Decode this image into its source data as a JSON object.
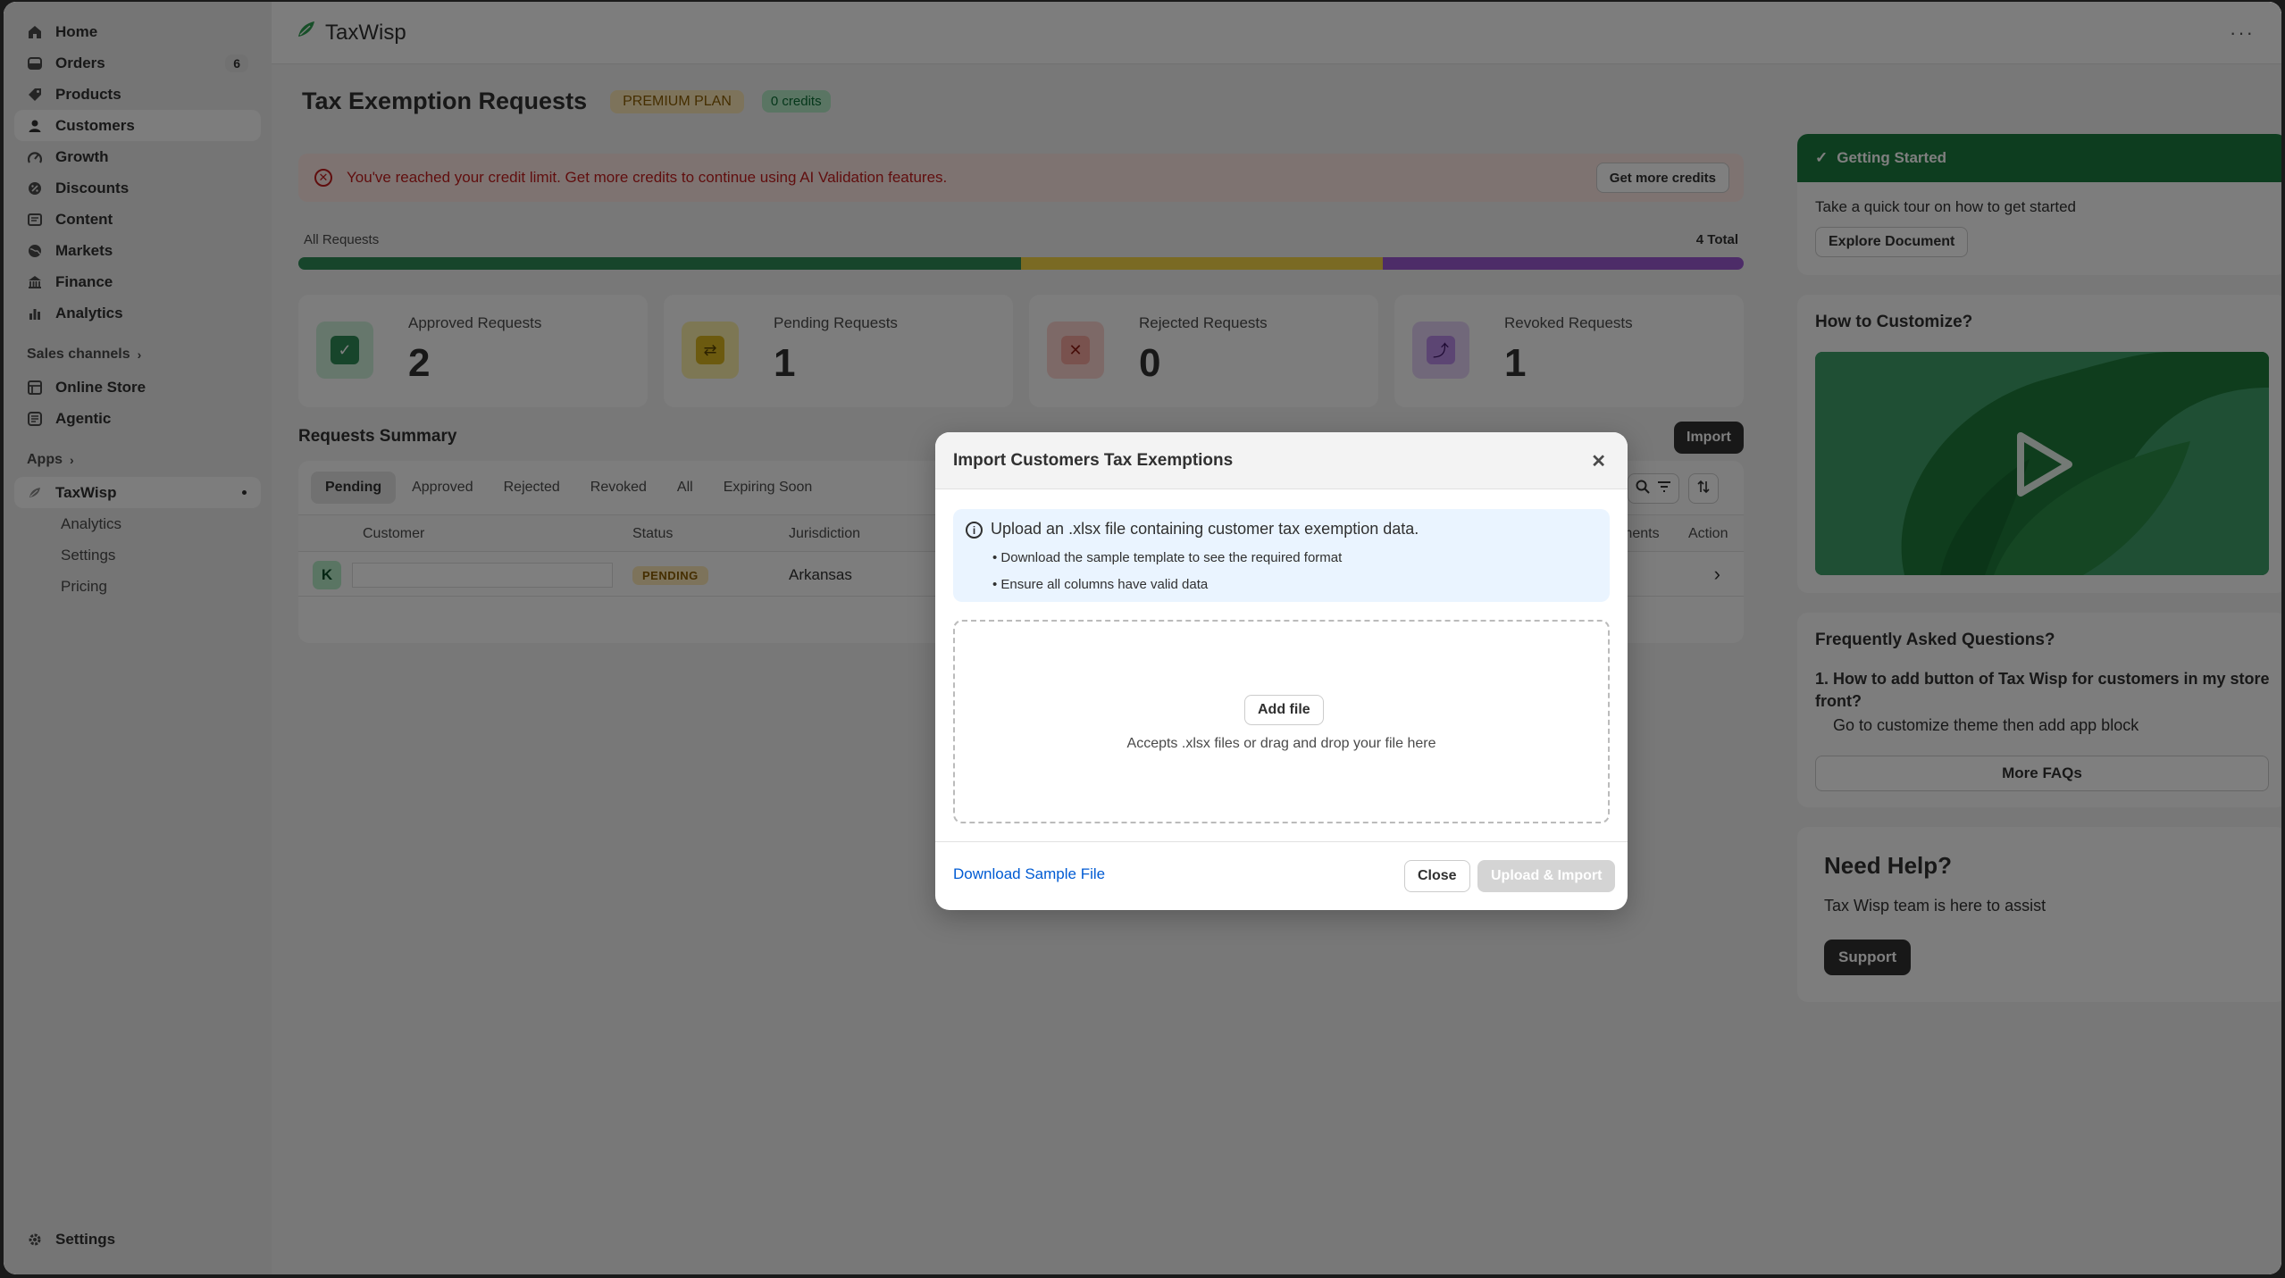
{
  "colors": {
    "brand": "#1b7a3e",
    "approved": "#2e8b57",
    "pending": "#f5d547",
    "revoked": "#9b59d0",
    "critical": "#c11d1d",
    "link": "#005bd3"
  },
  "sidebar": {
    "items": [
      {
        "label": "Home",
        "icon": "home-icon"
      },
      {
        "label": "Orders",
        "icon": "orders-icon",
        "badge": "6"
      },
      {
        "label": "Products",
        "icon": "tag-icon"
      },
      {
        "label": "Customers",
        "icon": "person-icon"
      },
      {
        "label": "Growth",
        "icon": "growth-icon"
      },
      {
        "label": "Discounts",
        "icon": "discount-icon"
      },
      {
        "label": "Content",
        "icon": "content-icon"
      },
      {
        "label": "Markets",
        "icon": "globe-icon"
      },
      {
        "label": "Finance",
        "icon": "bank-icon"
      },
      {
        "label": "Analytics",
        "icon": "bar-chart-icon"
      }
    ],
    "sales_channels_label": "Sales channels",
    "channels": [
      {
        "label": "Online Store",
        "icon": "store-icon"
      },
      {
        "label": "Agentic",
        "icon": "agentic-icon"
      }
    ],
    "apps_label": "Apps",
    "app": {
      "label": "TaxWisp",
      "icon": "taxwisp-logo-icon"
    },
    "app_sub": [
      "Analytics",
      "Settings",
      "Pricing"
    ],
    "settings_label": "Settings"
  },
  "header": {
    "app_name": "TaxWisp",
    "more": "···"
  },
  "page": {
    "title": "Tax Exemption Requests",
    "plan_badge": "PREMIUM PLAN",
    "credits_badge": "0 credits"
  },
  "alert": {
    "text": "You've reached your credit limit. Get more credits to continue using AI Validation features.",
    "button": "Get more credits"
  },
  "requests_bar": {
    "label": "All Requests",
    "total": "4 Total",
    "segments": [
      {
        "name": "Approved",
        "fraction": 0.5,
        "color": "#2e8b57"
      },
      {
        "name": "Pending",
        "fraction": 0.25,
        "color": "#f5d547"
      },
      {
        "name": "Revoked",
        "fraction": 0.25,
        "color": "#9b59d0"
      }
    ]
  },
  "stats": [
    {
      "label": "Approved Requests",
      "value": "2",
      "icon": "check-icon",
      "glyph": "✓"
    },
    {
      "label": "Pending Requests",
      "value": "1",
      "icon": "refresh-icon",
      "glyph": "⇄"
    },
    {
      "label": "Rejected Requests",
      "value": "0",
      "icon": "x-icon",
      "glyph": "✕"
    },
    {
      "label": "Revoked Requests",
      "value": "1",
      "icon": "undo-icon",
      "glyph": "⤴"
    }
  ],
  "summary": {
    "title": "Requests Summary",
    "import_button": "Import",
    "tabs": [
      "Pending",
      "Approved",
      "Rejected",
      "Revoked",
      "All",
      "Expiring Soon"
    ],
    "columns": {
      "customer": "Customer",
      "status": "Status",
      "jurisdiction": "Jurisdiction",
      "documents": "ments",
      "action": "Action"
    },
    "rows": [
      {
        "avatar": "K",
        "status": "PENDING",
        "jurisdiction": "Arkansas"
      }
    ]
  },
  "getting_started": {
    "title": "Getting Started",
    "text": "Take a quick tour on how to get started",
    "button": "Explore Document"
  },
  "customize": {
    "title": "How to Customize?"
  },
  "faq": {
    "title": "Frequently Asked Questions?",
    "items": [
      {
        "q": "1. How to add button of Tax Wisp for customers in my store front?",
        "a": "Go to customize theme then add app block"
      }
    ],
    "button": "More FAQs"
  },
  "help": {
    "title": "Need Help?",
    "text": "Tax Wisp team is here to assist",
    "button": "Support"
  },
  "modal": {
    "title": "Import Customers Tax Exemptions",
    "info_title": "Upload an .xlsx file containing customer tax exemption data.",
    "bullets": [
      "• Download the sample template to see the required format",
      "• Ensure all columns have valid data"
    ],
    "add_file": "Add file",
    "drop_text": "Accepts .xlsx files or drag and drop your file here",
    "download_link": "Download Sample File",
    "close_button": "Close",
    "upload_button": "Upload & Import"
  }
}
